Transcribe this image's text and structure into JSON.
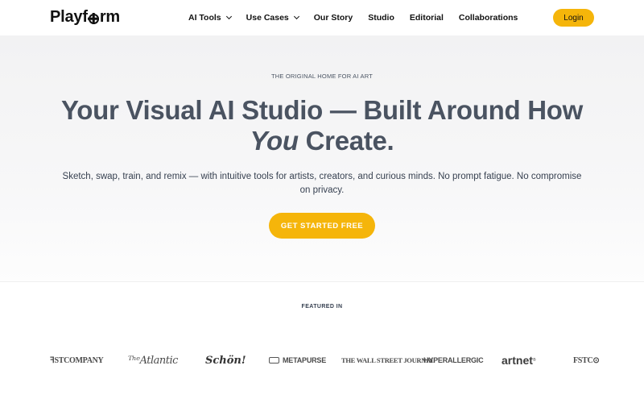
{
  "header": {
    "logo_text_before": "Playf",
    "logo_text_after": "rm",
    "nav": [
      {
        "label": "AI Tools",
        "has_dropdown": true
      },
      {
        "label": "Use Cases",
        "has_dropdown": true
      },
      {
        "label": "Our Story",
        "has_dropdown": false
      },
      {
        "label": "Studio",
        "has_dropdown": false
      },
      {
        "label": "Editorial",
        "has_dropdown": false
      },
      {
        "label": "Collaborations",
        "has_dropdown": false
      }
    ],
    "login_label": "Login"
  },
  "hero": {
    "eyebrow": "THE ORIGINAL HOME FOR AI ART",
    "headline_line1": "Your Visual AI Studio — Built Around How",
    "headline_emphasis": "You",
    "headline_line2_rest": " Create.",
    "subhead": "Sketch, swap, train, and remix — with intuitive tools for artists, creators, and curious minds. No prompt fatigue. No compromise on privacy.",
    "cta_label": "GET STARTED FREE"
  },
  "featured": {
    "label": "FEATURED IN",
    "logos": [
      {
        "name": "fast-company",
        "text": "ꟻSTCOMPANY"
      },
      {
        "name": "the-atlantic",
        "text": "ᵀʰᵉAtlantic"
      },
      {
        "name": "schon",
        "text": "Schön!"
      },
      {
        "name": "metapurse",
        "text": "METAPURSE"
      },
      {
        "name": "wall-street-journal",
        "text": "THE WALL STREET JOURNAL"
      },
      {
        "name": "hyperallergic",
        "text": "HYPERALLERGIC"
      },
      {
        "name": "artnet",
        "text": "artnet",
        "mark": "®"
      },
      {
        "name": "fast-company-2",
        "text": "FSTC⊙"
      }
    ]
  },
  "colors": {
    "accent": "#f5b50a",
    "heading": "#4a5361",
    "hero_bg": "#f2f2f3"
  }
}
